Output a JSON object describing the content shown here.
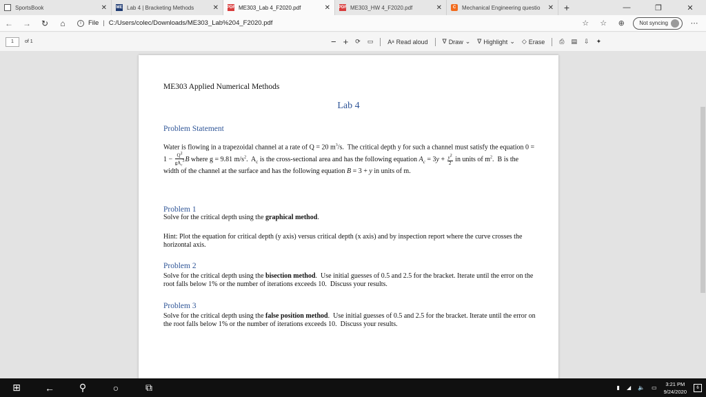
{
  "tabs": [
    {
      "title": "SportsBook",
      "icon": "page-icon"
    },
    {
      "title": "Lab 4 | Bracketing Methods",
      "icon": "lab-icon",
      "badge": "ME"
    },
    {
      "title": "ME303_Lab 4_F2020.pdf",
      "icon": "pdf-icon",
      "badge": "PDF"
    },
    {
      "title": "ME303_HW 4_F2020.pdf",
      "icon": "pdf-icon",
      "badge": "PDF"
    },
    {
      "title": "Mechanical Engineering questio",
      "icon": "chegg-icon",
      "badge": "C"
    }
  ],
  "address": {
    "prefix": "File",
    "url": "C:/Users/colec/Downloads/ME303_Lab%204_F2020.pdf"
  },
  "sync_label": "Not syncing",
  "pdf_toolbar": {
    "page_number": "1",
    "page_of": "of 1",
    "read_aloud": "Read aloud",
    "draw": "Draw",
    "highlight": "Highlight",
    "erase": "Erase"
  },
  "document": {
    "course": "ME303 Applied Numerical Methods",
    "lab_title": "Lab 4",
    "problem_statement_heading": "Problem Statement",
    "problem1_heading": "Problem 1",
    "problem1_hint_label": "Hint:",
    "problem2_heading": "Problem 2",
    "problem3_heading": "Problem 3"
  },
  "taskbar": {
    "time": "3:21 PM",
    "date": "9/24/2020",
    "notifications": "6"
  },
  "colors": {
    "heading_blue": "#2f5597",
    "taskbar": "#101010"
  }
}
